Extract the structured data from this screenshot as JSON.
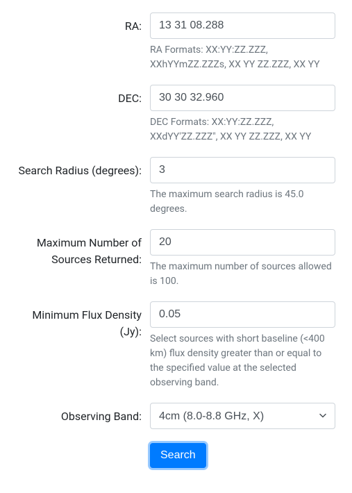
{
  "fields": {
    "ra": {
      "label": "RA:",
      "value": "13 31 08.288",
      "help": "RA Formats: XX:YY:ZZ.ZZZ, XXhYYmZZ.ZZZs, XX YY ZZ.ZZZ, XX YY"
    },
    "dec": {
      "label": "DEC:",
      "value": "30 30 32.960",
      "help": "DEC Formats: XX:YY:ZZ.ZZZ, XXdYY'ZZ.ZZZ\", XX YY ZZ.ZZZ, XX YY"
    },
    "radius": {
      "label": "Search Radius (degrees):",
      "value": "3",
      "help": "The maximum search radius is 45.0 degrees."
    },
    "max_sources": {
      "label": "Maximum Number of Sources Returned:",
      "value": "20",
      "help": "The maximum number of sources allowed is 100."
    },
    "min_flux": {
      "label": "Minimum Flux Density (Jy):",
      "value": "0.05",
      "help": "Select sources with short baseline (<400 km) flux density greater than or equal to the specified value at the selected observing band."
    },
    "band": {
      "label": "Observing Band:",
      "selected": "4cm (8.0-8.8 GHz, X)"
    }
  },
  "submit": {
    "label": "Search"
  }
}
